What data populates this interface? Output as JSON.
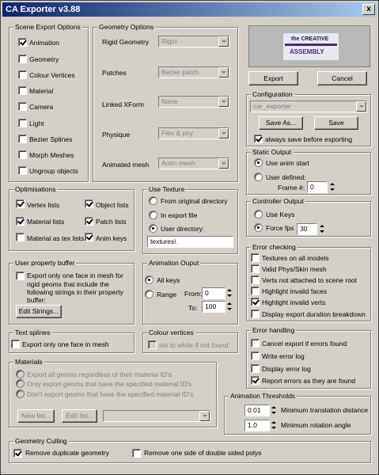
{
  "window": {
    "title": "CA Exporter v3.88",
    "close": "x"
  },
  "logo": {
    "line1": "the CREATIVE",
    "line2": "ASSEMBLY"
  },
  "scene_export": {
    "legend": "Scene Export Options",
    "items": [
      {
        "label": "Animation",
        "checked": true
      },
      {
        "label": "Geometry",
        "checked": false
      },
      {
        "label": "Colour Vertices",
        "checked": false
      },
      {
        "label": "Material",
        "checked": false
      },
      {
        "label": "Camera",
        "checked": false
      },
      {
        "label": "Light",
        "checked": false
      },
      {
        "label": "Bezier Splines",
        "checked": false
      },
      {
        "label": "Morph Meshes",
        "checked": false
      },
      {
        "label": "Ungroup objects",
        "checked": false
      }
    ]
  },
  "geometry": {
    "legend": "Geometry Options",
    "rigid_label": "Rigid Geometry",
    "rigid_value": "Rigid",
    "patches_label": "Patches",
    "patches_value": "Bezier patch",
    "linked_label": "Linked XForm",
    "linked_value": "None",
    "physique_label": "Physique",
    "physique_value": "Flex & phy",
    "animated_label": "Animated mesh",
    "animated_value": "Anim mesh"
  },
  "actions": {
    "export": "Export",
    "cancel": "Cancel"
  },
  "configuration": {
    "legend": "Configuration",
    "value": "car_exporter",
    "save_as": "Save As...",
    "save": "Save",
    "always_save": "always save before exporting"
  },
  "static_output": {
    "legend": "Static Output",
    "use_anim_start": "Use anim start",
    "user_defined": "User defined:",
    "frame_label": "Frame #:",
    "frame_value": "0"
  },
  "controller_output": {
    "legend": "Controller Output",
    "use_keys": "Use Keys",
    "force_fps": "Force fps",
    "fps_value": "30"
  },
  "error_checking": {
    "legend": "Error checking",
    "items": [
      {
        "label": "Textures on all models",
        "checked": false
      },
      {
        "label": "Valid Phys/Skin mesh",
        "checked": false
      },
      {
        "label": "Verts not attached to scene root",
        "checked": false
      },
      {
        "label": "Highlight invalid faces",
        "checked": false
      },
      {
        "label": "Highlight invalid verts",
        "checked": true
      },
      {
        "label": "Display export duration breakdown",
        "checked": false
      }
    ]
  },
  "error_handling": {
    "legend": "Error handling",
    "items": [
      {
        "label": "Cancel export if errors found",
        "checked": false
      },
      {
        "label": "Write error log",
        "checked": false
      },
      {
        "label": "Display error log",
        "checked": false
      },
      {
        "label": "Report errors as they are found",
        "checked": true
      }
    ]
  },
  "anim_thresholds": {
    "legend": "Animation Thresholds",
    "translation_value": "0.01",
    "translation_label": "Minimum translation distance",
    "rotation_value": "1.0",
    "rotation_label": "Minimum rotation angle"
  },
  "optimisations": {
    "legend": "Optimisations",
    "vertex": "Vertex lists",
    "object": "Object lists",
    "material": "Material lists",
    "patch": "Patch lists",
    "material_tex": "Material as tex lists",
    "anim_keys": "Anim keys"
  },
  "use_texture": {
    "legend": "Use Texture",
    "from_original": "From original directory",
    "in_export": "In export file",
    "user_dir": "User directory:",
    "dir_value": "textures\\"
  },
  "user_property": {
    "legend": "User property buffer",
    "text1": "Export only one face in mesh for",
    "text2": "rigid geoms that include the",
    "text3": "following strings in their property",
    "text4": "buffer:",
    "edit": "Edit Strings..."
  },
  "anim_output": {
    "legend": "Animation Ouput",
    "all_keys": "All keys",
    "range": "Range",
    "from_label": "From:",
    "from_value": "0",
    "to_label": "To:",
    "to_value": "100"
  },
  "text_splines": {
    "legend": "Text splines",
    "label": "Export only one face in mesh"
  },
  "colour_vertices": {
    "legend": "Colour vertices",
    "label": "set to white if not found"
  },
  "materials": {
    "legend": "Materials",
    "opt1": "Export all geoms regardless of their material ID's",
    "opt2": "Only export geoms that have the specified material ID's",
    "opt3": "Don't export geoms that have the specified material ID's",
    "new_list": "New list...",
    "edit_list": "Edit list..."
  },
  "geometry_culling": {
    "legend": "Geometry Culling",
    "remove_duplicate": "Remove duplicate geometry",
    "remove_one_side": "Remove one side of double sided polys"
  }
}
